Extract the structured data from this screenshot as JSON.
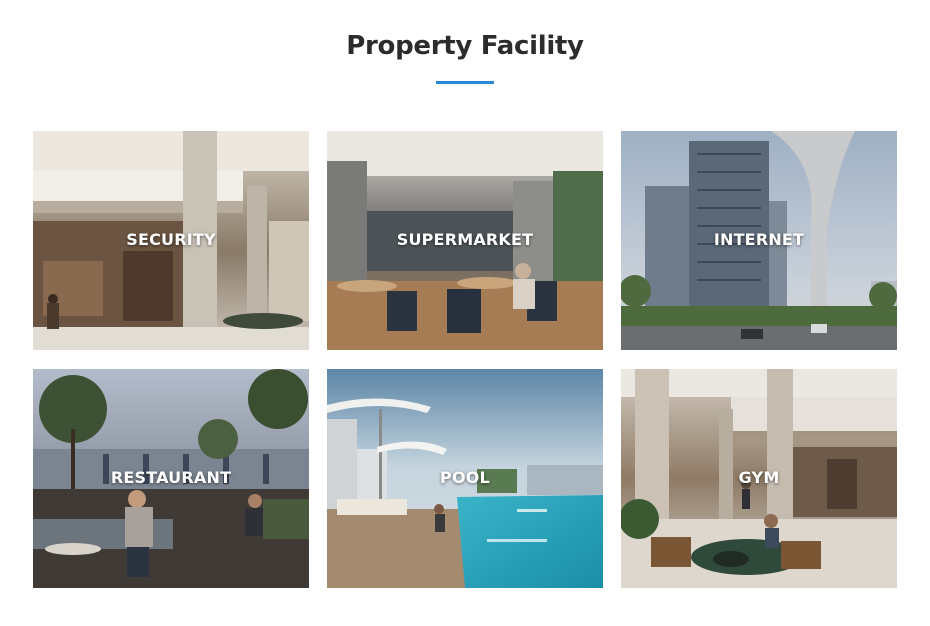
{
  "section": {
    "title": "Property Facility",
    "accent_color": "#2a88d8"
  },
  "facilities": [
    {
      "label": "SECURITY",
      "image": "hotel-lobby-photo"
    },
    {
      "label": "SUPERMARKET",
      "image": "cafe-seating-photo"
    },
    {
      "label": "INTERNET",
      "image": "tower-building-photo"
    },
    {
      "label": "RESTAURANT",
      "image": "rooftop-dining-photo"
    },
    {
      "label": "POOL",
      "image": "rooftop-pool-photo"
    },
    {
      "label": "GYM",
      "image": "atrium-lounge-photo"
    }
  ]
}
